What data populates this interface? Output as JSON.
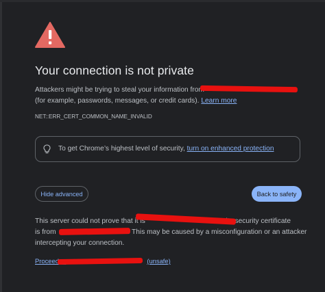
{
  "colors": {
    "background": "#202124",
    "title_text": "#e8eaed",
    "body_text": "#bdc1c6",
    "link": "#8ab4f8",
    "warning_icon": "#e46962",
    "button_primary_bg": "#8ab4f8",
    "outline": "#5f6368",
    "redaction": "#e8110f"
  },
  "icons": {
    "warning": "warning-triangle-icon",
    "lightbulb": "lightbulb-icon"
  },
  "page": {
    "title": "Your connection is not private",
    "intro_line1": "Attackers might be trying to steal your information from",
    "intro_line2": "(for example, passwords, messages, or credit cards).",
    "learn_more": "Learn more",
    "error_code": "NET::ERR_CERT_COMMON_NAME_INVALID"
  },
  "callout": {
    "text": "To get Chrome’s highest level of security,",
    "link": "turn on enhanced protection"
  },
  "buttons": {
    "hide_advanced": "Hide advanced",
    "back_to_safety": "Back to safety"
  },
  "advanced": {
    "line1_a": "This server could not prove that it is",
    "line1_b": "; its security certificate",
    "line2_a": "is from",
    "line2_b": ". This may be caused by a misconfiguration or an attacker",
    "line3": "intercepting your connection.",
    "proceed_prefix": "Proceed to",
    "proceed_suffix": "(unsafe)"
  }
}
